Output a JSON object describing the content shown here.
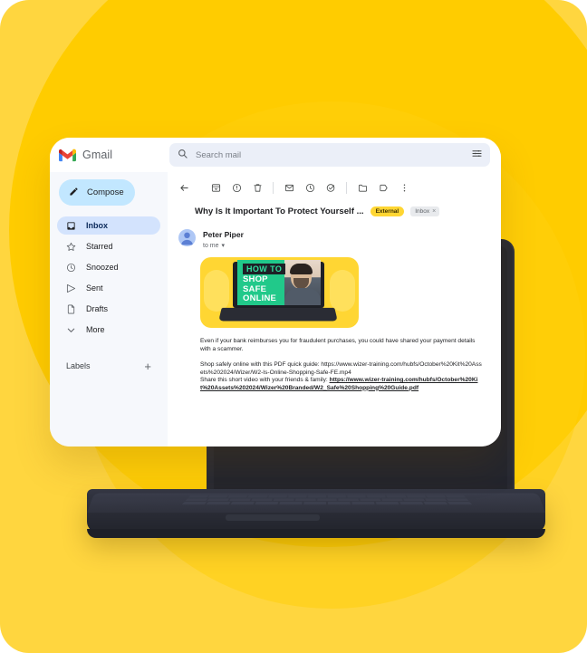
{
  "theme": {
    "bg_yellow": "#FFD63F",
    "circle_yellow": "#FFCC00",
    "laptop_dark": "#282A33",
    "accent_blue": "#C2E7FF",
    "active_blue": "#D3E3FD",
    "badge_yellow": "#FFD633",
    "thumb_green": "#21C98A"
  },
  "app": {
    "brand_name": "Gmail",
    "logo_icon": "gmail-m-logo"
  },
  "search": {
    "placeholder": "Search mail",
    "value": "",
    "search_icon": "search-icon",
    "options_icon": "tune-options-icon"
  },
  "sidebar": {
    "compose": {
      "label": "Compose",
      "icon": "pencil-icon"
    },
    "items": [
      {
        "label": "Inbox",
        "icon": "inbox-icon",
        "active": true
      },
      {
        "label": "Starred",
        "icon": "star-icon",
        "active": false
      },
      {
        "label": "Snoozed",
        "icon": "clock-icon",
        "active": false
      },
      {
        "label": "Sent",
        "icon": "send-icon",
        "active": false
      },
      {
        "label": "Drafts",
        "icon": "document-icon",
        "active": false
      },
      {
        "label": "More",
        "icon": "chevron-down-icon",
        "active": false
      }
    ],
    "labels": {
      "title": "Labels",
      "add_label": "+",
      "add_icon": "plus-icon"
    }
  },
  "toolbar": {
    "buttons": [
      {
        "name": "back-icon",
        "title": "Back to inbox"
      },
      {
        "name": "archive-icon",
        "title": "Archive"
      },
      {
        "name": "report-spam-icon",
        "title": "Report spam"
      },
      {
        "name": "delete-icon",
        "title": "Delete"
      },
      {
        "name": "mark-unread-icon",
        "title": "Mark as unread"
      },
      {
        "name": "snooze-icon",
        "title": "Snooze"
      },
      {
        "name": "add-to-tasks-icon",
        "title": "Add to tasks"
      },
      {
        "name": "move-to-icon",
        "title": "Move to"
      },
      {
        "name": "label-icon",
        "title": "Labels"
      },
      {
        "name": "more-options-icon",
        "title": "More"
      }
    ]
  },
  "email": {
    "subject": "Why Is It Important To Protect Yourself ...",
    "badge_external": "External",
    "chip_inbox": "Inbox",
    "chip_close": "×",
    "sender_name": "Peter Piper",
    "recipient": "to me",
    "recipient_caret": "▾",
    "avatar_icon": "person-avatar-icon",
    "hero": {
      "kicker": "HOW TO",
      "line1": "SHOP",
      "line2": "SAFE",
      "line3": "ONLINE",
      "alt": "how-to-shop-safe-online-video-thumbnail"
    },
    "paragraph_1": "Even if your bank reimburses you for fraudulent purchases, you could have shared your payment details with a scammer.",
    "paragraph_2_prefix": "Shop safely online with this PDF quick guide: ",
    "paragraph_2_url": "https://www.wizer-training.com/hubfs/October%20Kit%20Assets%202024/Wizer/W2-Is-Online-Shopping-Safe-FE.mp4",
    "paragraph_3_prefix": "Share this short video with your friends & family: ",
    "paragraph_3_url": "https://www.wizer-training.com/hubfs/October%20Kit%20Assets%202024/Wizer%20Branded/W2_Safe%20Shopping%20Guide.pdf"
  }
}
